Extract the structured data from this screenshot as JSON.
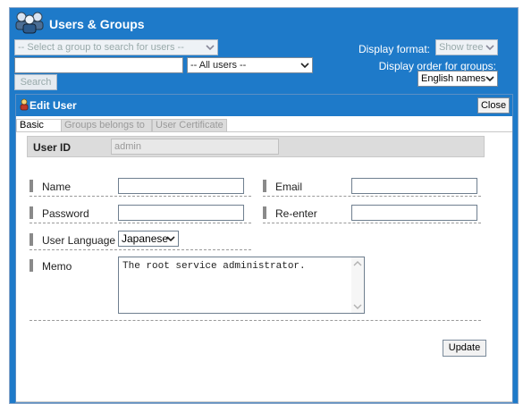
{
  "app": {
    "title": "Users & Groups",
    "colors": {
      "header": "#1e7ac9",
      "dialog_border": "#5c8fc4"
    }
  },
  "toolbar": {
    "group_select_placeholder": "-- Select a group to search for users --",
    "user_filter_selected": "-- All users --",
    "search_label": "Search",
    "display_format_label": "Display format:",
    "display_format_selected": "Show tree",
    "display_order_label": "Display order for groups:",
    "display_order_selected": "English names"
  },
  "dialog": {
    "title": "Edit User",
    "close_label": "Close",
    "tabs": [
      {
        "label": "Basic",
        "active": true
      },
      {
        "label": "Groups belongs to",
        "active": false
      },
      {
        "label": "User Certificate",
        "active": false
      }
    ],
    "user_id_label": "User ID",
    "user_id_value": "admin",
    "fields": {
      "name_label": "Name",
      "email_label": "Email",
      "password_label": "Password",
      "reenter_label": "Re-enter",
      "language_label": "User Language",
      "language_selected": "Japanese",
      "memo_label": "Memo",
      "memo_value": "The root service administrator."
    },
    "update_label": "Update"
  }
}
